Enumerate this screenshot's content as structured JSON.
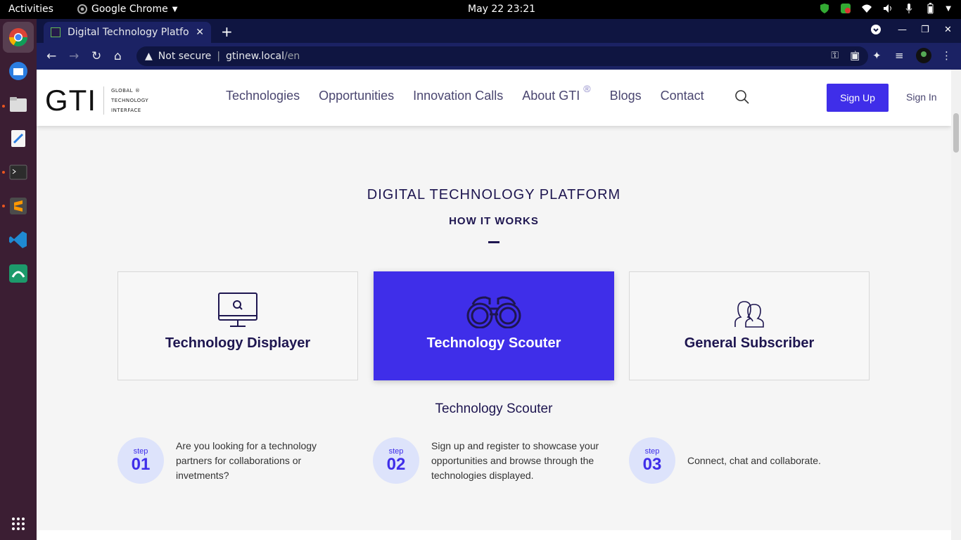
{
  "os": {
    "activities": "Activities",
    "app_name": "Google Chrome",
    "clock": "May 22  23:21"
  },
  "browser": {
    "tab_title": "Digital Technology Platfo",
    "security": "Not secure",
    "url_host": "gtinew.local",
    "url_path": "/en"
  },
  "site": {
    "logo_text": "GTI",
    "logo_sub": [
      "GLOBAL",
      "TECHNOLOGY",
      "INTERFACE"
    ],
    "logo_reg": "®",
    "nav": [
      "Technologies",
      "Opportunities",
      "Innovation Calls",
      "About GTI",
      "Blogs",
      "Contact"
    ],
    "nav_reg": "®",
    "signup": "Sign Up",
    "signin": "Sign In"
  },
  "main": {
    "title": "DIGITAL TECHNOLOGY PLATFORM",
    "subtitle": "HOW IT WORKS",
    "cards": [
      {
        "label": "Technology Displayer",
        "icon": "monitor-search-icon"
      },
      {
        "label": "Technology Scouter",
        "icon": "binoculars-icon"
      },
      {
        "label": "General Subscriber",
        "icon": "users-icon"
      }
    ],
    "selected_title": "Technology Scouter",
    "steps": [
      {
        "step": "step",
        "num": "01",
        "text": "Are you looking for a technology partners for collaborations or invetments?"
      },
      {
        "step": "step",
        "num": "02",
        "text": "Sign up and register to showcase your opportunities and browse through the technologies displayed."
      },
      {
        "step": "step",
        "num": "03",
        "text": "Connect, chat and collaborate."
      }
    ]
  },
  "colors": {
    "accent": "#3f2ee9",
    "heading": "#1e1650",
    "step_circle": "#dde3fb"
  }
}
